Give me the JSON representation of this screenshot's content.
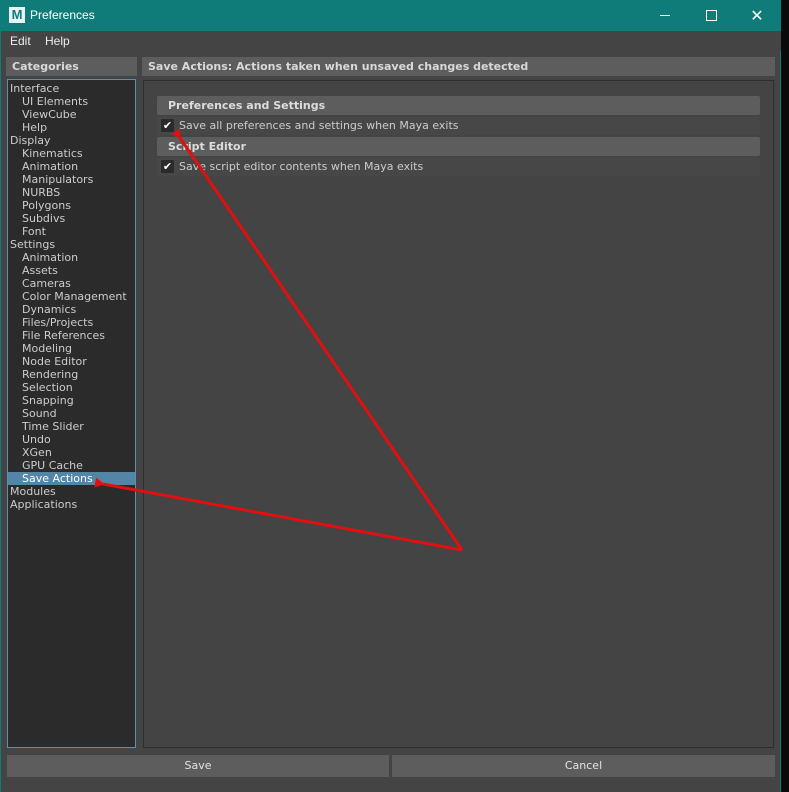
{
  "window": {
    "title": "Preferences",
    "icon_letter": "M",
    "minimize_glyph": "",
    "maximize_glyph": "",
    "close_glyph": "✕"
  },
  "menu": [
    "Edit",
    "Help"
  ],
  "categories": {
    "header": "Categories",
    "items": [
      {
        "label": "Interface",
        "level": 0
      },
      {
        "label": "UI Elements",
        "level": 1
      },
      {
        "label": "ViewCube",
        "level": 1
      },
      {
        "label": "Help",
        "level": 1
      },
      {
        "label": "Display",
        "level": 0
      },
      {
        "label": "Kinematics",
        "level": 1
      },
      {
        "label": "Animation",
        "level": 1
      },
      {
        "label": "Manipulators",
        "level": 1
      },
      {
        "label": "NURBS",
        "level": 1
      },
      {
        "label": "Polygons",
        "level": 1
      },
      {
        "label": "Subdivs",
        "level": 1
      },
      {
        "label": "Font",
        "level": 1
      },
      {
        "label": "Settings",
        "level": 0
      },
      {
        "label": "Animation",
        "level": 1
      },
      {
        "label": "Assets",
        "level": 1
      },
      {
        "label": "Cameras",
        "level": 1
      },
      {
        "label": "Color Management",
        "level": 1
      },
      {
        "label": "Dynamics",
        "level": 1
      },
      {
        "label": "Files/Projects",
        "level": 1
      },
      {
        "label": "File References",
        "level": 1
      },
      {
        "label": "Modeling",
        "level": 1
      },
      {
        "label": "Node Editor",
        "level": 1
      },
      {
        "label": "Rendering",
        "level": 1
      },
      {
        "label": "Selection",
        "level": 1
      },
      {
        "label": "Snapping",
        "level": 1
      },
      {
        "label": "Sound",
        "level": 1
      },
      {
        "label": "Time Slider",
        "level": 1
      },
      {
        "label": "Undo",
        "level": 1
      },
      {
        "label": "XGen",
        "level": 1
      },
      {
        "label": "GPU Cache",
        "level": 1
      },
      {
        "label": "Save Actions",
        "level": 1,
        "selected": true
      },
      {
        "label": "Modules",
        "level": 0
      },
      {
        "label": "Applications",
        "level": 0
      }
    ]
  },
  "main": {
    "header": "Save Actions: Actions taken when unsaved changes detected",
    "sections": [
      {
        "title": "Preferences and Settings",
        "option": {
          "label": "Save all preferences and settings when Maya exits",
          "checked": true
        }
      },
      {
        "title": "Script Editor",
        "option": {
          "label": "Save script editor contents when Maya exits",
          "checked": true
        }
      }
    ]
  },
  "buttons": {
    "save": "Save",
    "cancel": "Cancel"
  },
  "colors": {
    "titlebar": "#0f7c79",
    "selection": "#5285a6",
    "annotation_arrow": "#e01010"
  }
}
